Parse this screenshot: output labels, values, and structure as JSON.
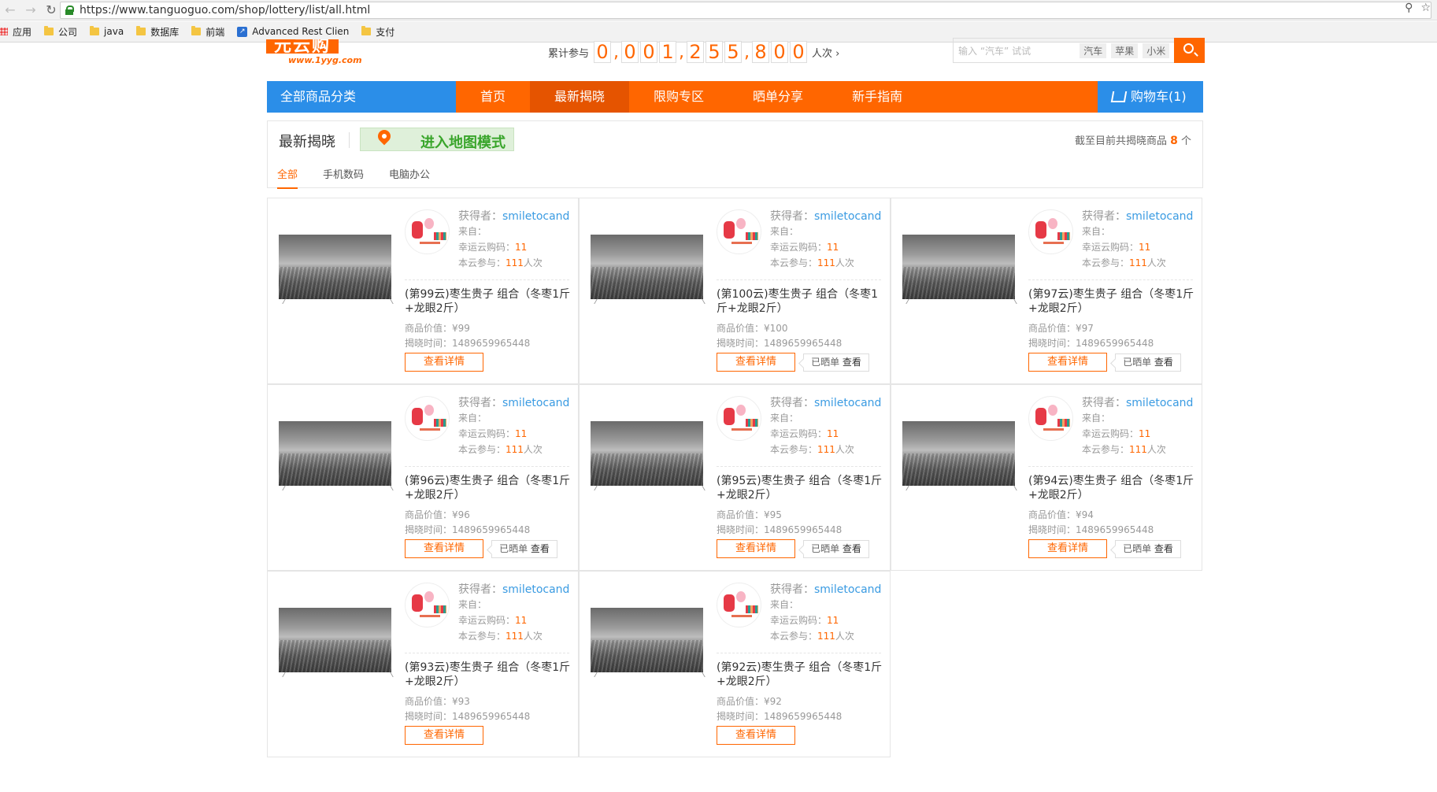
{
  "browser": {
    "url": "https://www.tanguoguo.com/shop/lottery/list/all.html",
    "bookmarks": [
      {
        "label": "应用",
        "icon": "apps-icon"
      },
      {
        "label": "公司",
        "icon": "folder-icon"
      },
      {
        "label": "java",
        "icon": "folder-icon"
      },
      {
        "label": "数据库",
        "icon": "folder-icon"
      },
      {
        "label": "前端",
        "icon": "folder-icon"
      },
      {
        "label": "Advanced Rest Clien",
        "icon": "arc-icon"
      },
      {
        "label": "支付",
        "icon": "folder-icon"
      }
    ]
  },
  "header": {
    "logo_text": "元云购",
    "logo_sub": "www.1yyg.com",
    "counter_label": "累计参与",
    "counter_digits": [
      "0",
      ",",
      "0",
      "0",
      "1",
      ",",
      "2",
      "5",
      "5",
      ",",
      "8",
      "0",
      "0"
    ],
    "counter_suffix": "人次 ›",
    "search_placeholder": "输入 “汽车” 试试",
    "hot_tags": [
      "汽车",
      "苹果",
      "小米"
    ]
  },
  "nav": {
    "category_all": "全部商品分类",
    "items": [
      "首页",
      "最新揭晓",
      "限购专区",
      "晒单分享",
      "新手指南"
    ],
    "active_index": 1,
    "cart": "购物车(1)"
  },
  "panel": {
    "title": "最新揭晓",
    "map_button": "进入地图模式",
    "count_prefix": "截至目前共揭晓商品",
    "count": "8",
    "count_suffix": "个",
    "tabs": [
      "全部",
      "手机数码",
      "电脑办公"
    ],
    "active_tab": 0
  },
  "labels": {
    "winner": "获得者：",
    "from": "来自：",
    "lucky_code": "幸运云购码：",
    "participate": "本云参与：",
    "times": "人次",
    "price": "商品价值：",
    "reveal_time": "揭晓时间：",
    "detail_button": "查看详情",
    "share_prefix": "已晒单",
    "share_look": "查看"
  },
  "products": [
    {
      "winner": "smiletocand",
      "lucky_code": "11",
      "participants": "111",
      "title": "(第99云)枣生贵子 组合（冬枣1斤+龙眼2斤）",
      "price": "¥99",
      "time": "1489659965448",
      "shared": false
    },
    {
      "winner": "smiletocand",
      "lucky_code": "11",
      "participants": "111",
      "title": "(第100云)枣生贵子 组合（冬枣1斤+龙眼2斤）",
      "price": "¥100",
      "time": "1489659965448",
      "shared": true
    },
    {
      "winner": "smiletocand",
      "lucky_code": "11",
      "participants": "111",
      "title": "(第97云)枣生贵子 组合（冬枣1斤+龙眼2斤）",
      "price": "¥97",
      "time": "1489659965448",
      "shared": true
    },
    {
      "winner": "smiletocand",
      "lucky_code": "11",
      "participants": "111",
      "title": "(第96云)枣生贵子 组合（冬枣1斤+龙眼2斤）",
      "price": "¥96",
      "time": "1489659965448",
      "shared": true
    },
    {
      "winner": "smiletocand",
      "lucky_code": "11",
      "participants": "111",
      "title": "(第95云)枣生贵子 组合（冬枣1斤+龙眼2斤）",
      "price": "¥95",
      "time": "1489659965448",
      "shared": true
    },
    {
      "winner": "smiletocand",
      "lucky_code": "11",
      "participants": "111",
      "title": "(第94云)枣生贵子 组合（冬枣1斤+龙眼2斤）",
      "price": "¥94",
      "time": "1489659965448",
      "shared": true
    },
    {
      "winner": "smiletocand",
      "lucky_code": "11",
      "participants": "111",
      "title": "(第93云)枣生贵子 组合（冬枣1斤+龙眼2斤）",
      "price": "¥93",
      "time": "1489659965448",
      "shared": false
    },
    {
      "winner": "smiletocand",
      "lucky_code": "11",
      "participants": "111",
      "title": "(第92云)枣生贵子 组合（冬枣1斤+龙眼2斤）",
      "price": "¥92",
      "time": "1489659965448",
      "shared": false
    }
  ],
  "colors": {
    "accent": "#ff6600",
    "blue": "#2b8ee8",
    "green": "#39a52b"
  }
}
